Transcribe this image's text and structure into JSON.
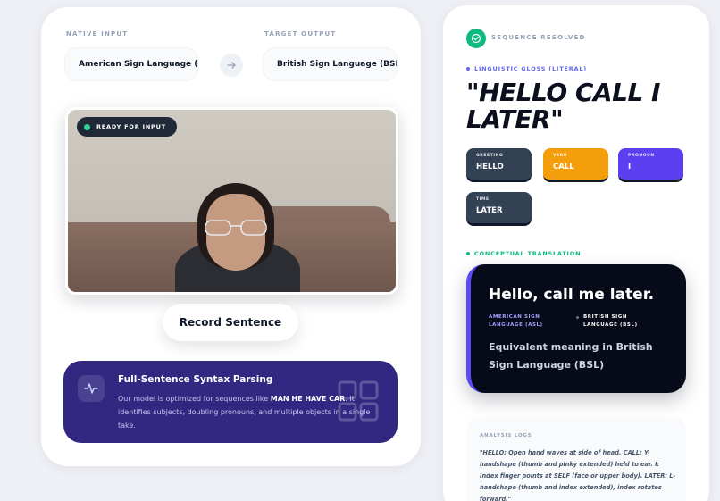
{
  "input": {
    "native_label": "NATIVE INPUT",
    "target_label": "TARGET OUTPUT",
    "native_value": "American Sign Language (A",
    "target_value": "British Sign Language (BSL)"
  },
  "camera": {
    "status": "READY FOR INPUT"
  },
  "record_button": "Record Sentence",
  "syntax": {
    "title": "Full-Sentence Syntax Parsing",
    "desc_before": "Our model is optimized for sequences like ",
    "desc_highlight": "MAN HE HAVE CAR",
    "desc_after": ". It identifies subjects, doubling pronouns, and multiple objects in a single take."
  },
  "result": {
    "status": "SEQUENCE RESOLVED",
    "gloss_label": "LINGUISTIC GLOSS (LITERAL)",
    "gloss": "\"HELLO CALL I LATER\"",
    "tokens": [
      {
        "type": "GREETING",
        "word": "HELLO",
        "color": "#334155"
      },
      {
        "type": "VERB",
        "word": "CALL",
        "color": "#f59e0b"
      },
      {
        "type": "PRONOUN",
        "word": "I",
        "color": "#5b3ff0"
      },
      {
        "type": "TIME",
        "word": "LATER",
        "color": "#334155"
      }
    ],
    "conceptual_label": "CONCEPTUAL TRANSLATION",
    "translation": "Hello, call me later.",
    "source_lang": "AMERICAN SIGN LANGUAGE (ASL)",
    "target_lang": "BRITISH SIGN LANGUAGE (BSL)",
    "equivalent": "Equivalent meaning in British Sign Language (BSL)",
    "logs_label": "ANALYSIS LOGS",
    "logs": "\"HELLO: Open hand waves at side of head. CALL: Y-handshape (thumb and pinky extended) held to ear. I: Index finger points at SELF (face or upper body). LATER: L-handshape (thumb and index extended), index rotates forward.\""
  },
  "colors": {
    "accent_purple": "#322781",
    "success_green": "#10b981",
    "dark_card": "#070a19"
  }
}
